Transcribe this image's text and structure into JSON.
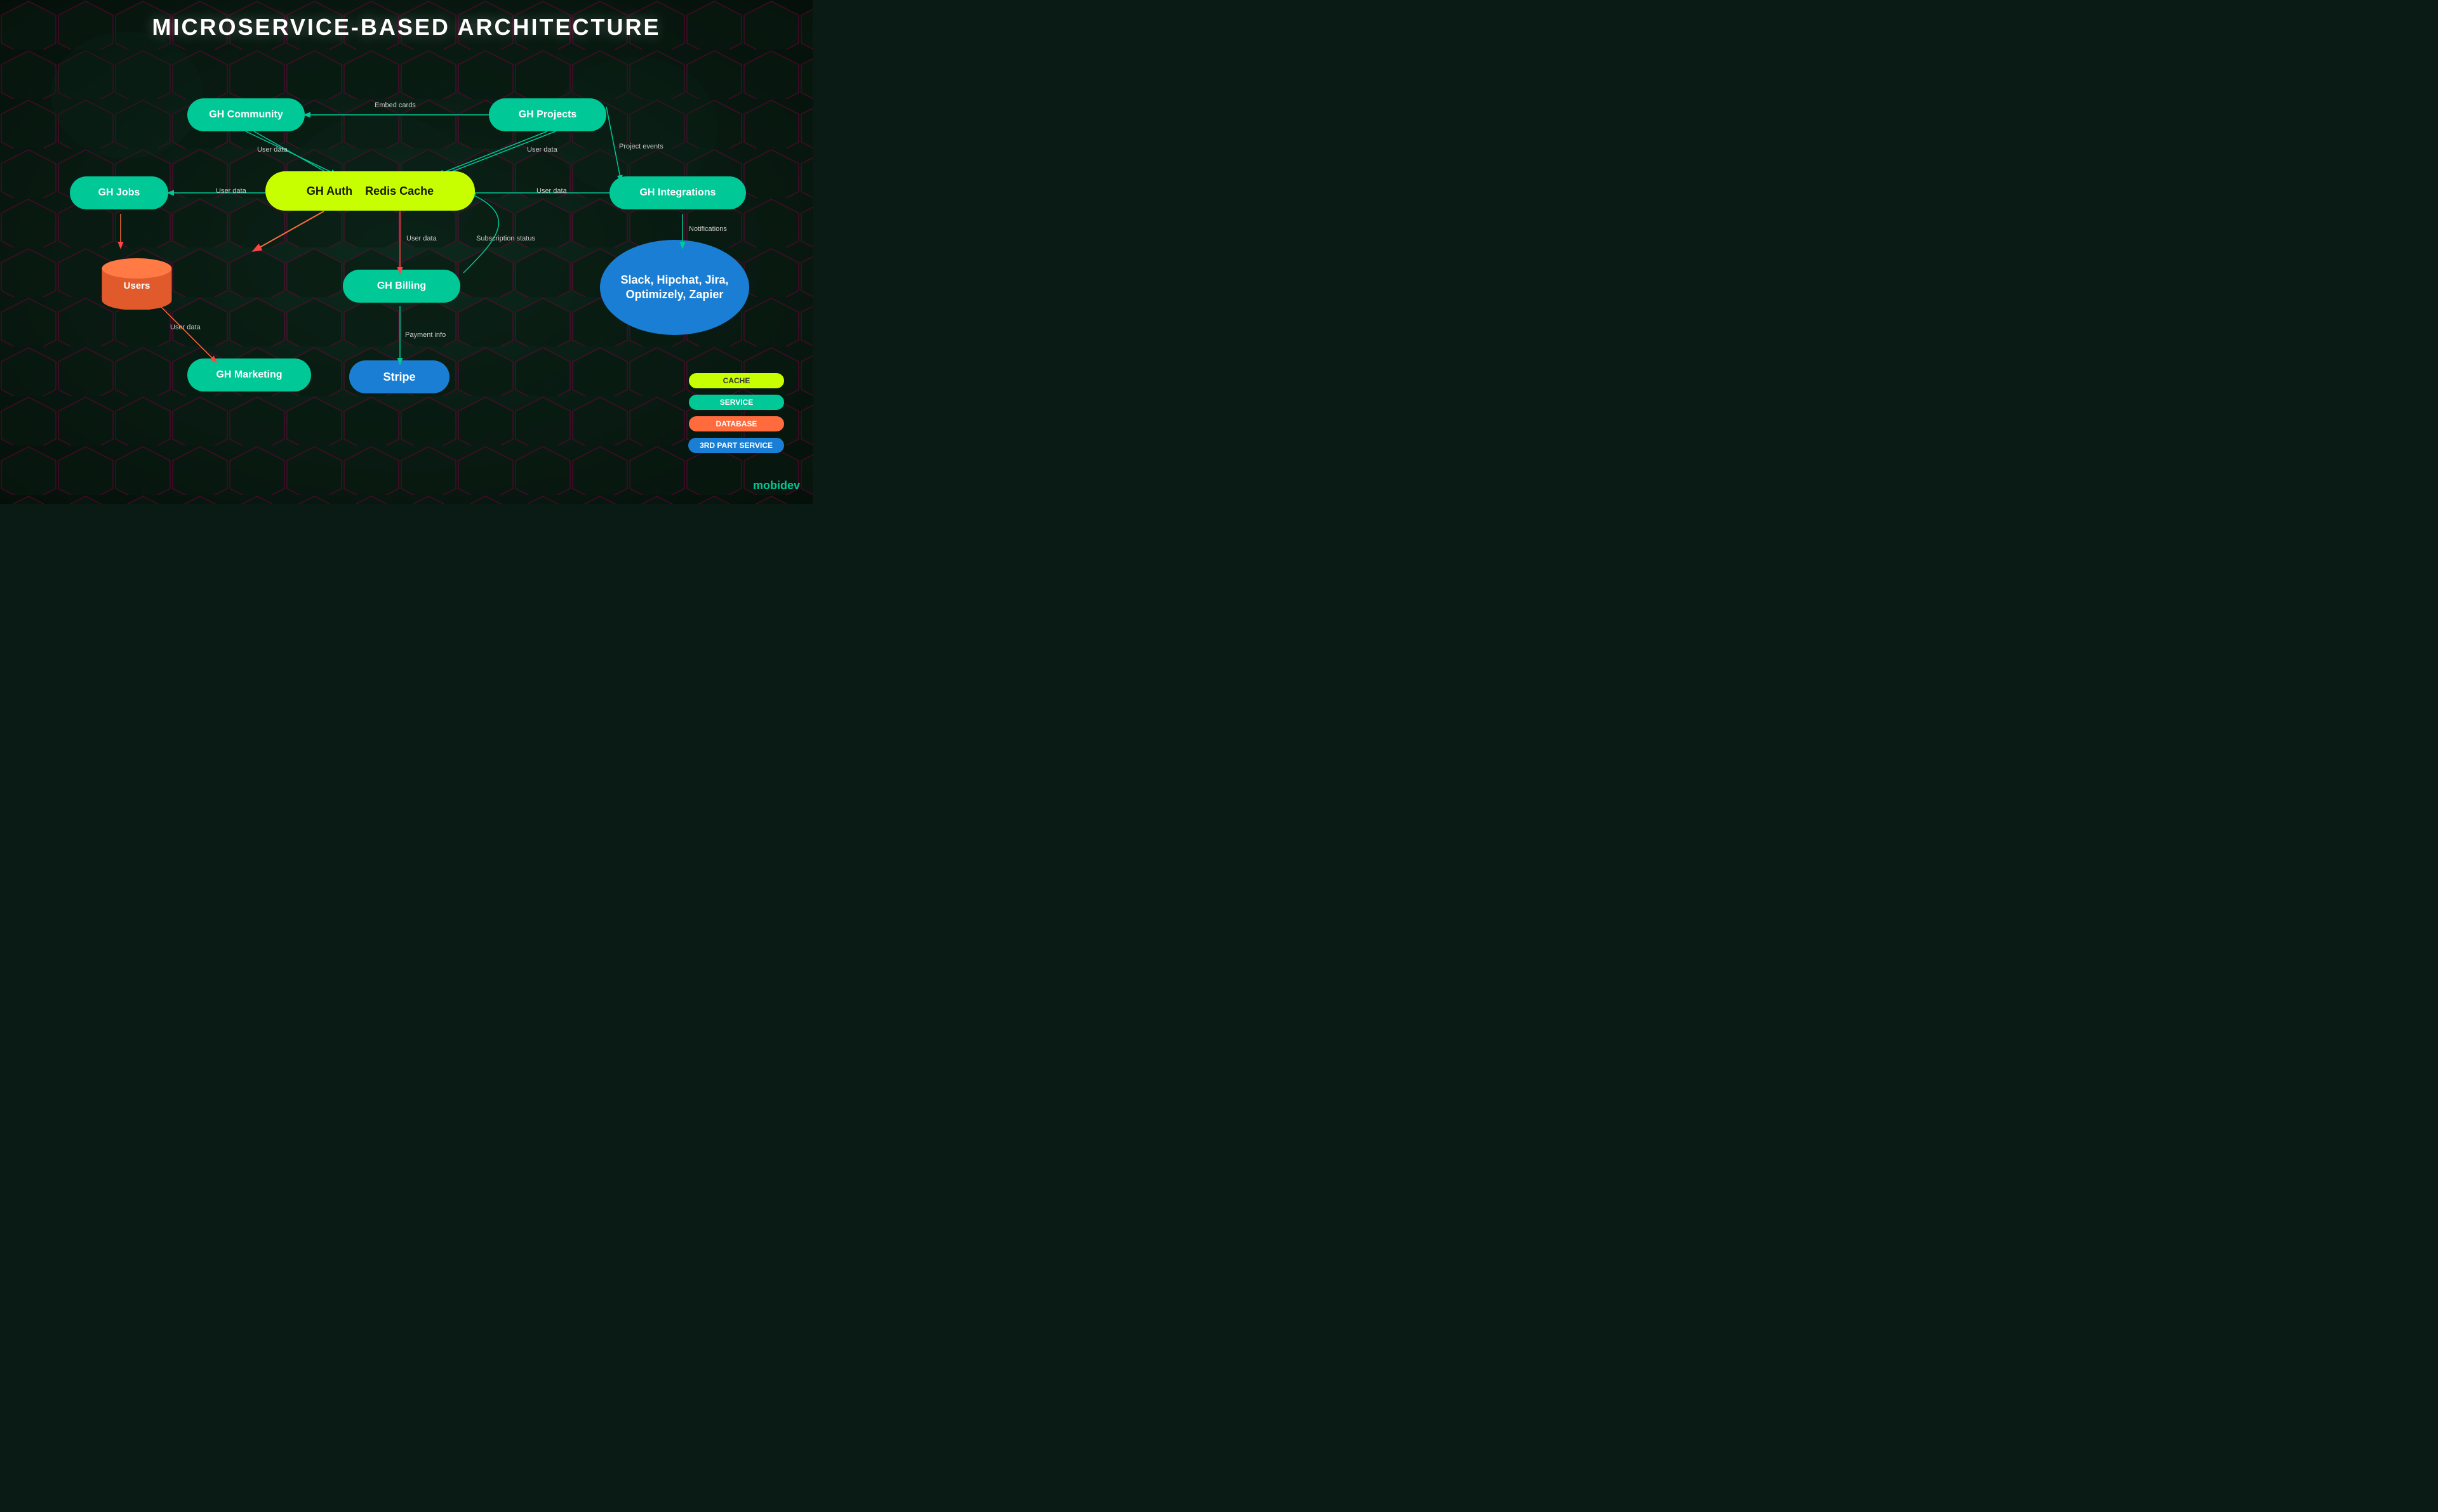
{
  "title": "MICROSERVICE-BASED ARCHITECTURE",
  "nodes": {
    "gh_community": {
      "label": "GH Community",
      "type": "service"
    },
    "gh_projects": {
      "label": "GH Projects",
      "type": "service"
    },
    "gh_jobs": {
      "label": "GH Jobs",
      "type": "service"
    },
    "gh_auth": {
      "label": "GH Auth",
      "type": "cache"
    },
    "redis_cache": {
      "label": "Redis Cache",
      "type": "cache"
    },
    "gh_integrations": {
      "label": "GH Integrations",
      "type": "service"
    },
    "users": {
      "label": "Users",
      "type": "database"
    },
    "gh_billing": {
      "label": "GH Billing",
      "type": "service"
    },
    "integrations_services": {
      "label": "Slack, Hipchat, Jira, Optimizely, Zapier",
      "type": "3rdparty"
    },
    "gh_marketing": {
      "label": "GH Marketing",
      "type": "service"
    },
    "stripe": {
      "label": "Stripe",
      "type": "3rdparty_service"
    }
  },
  "edge_labels": {
    "embed_cards": "Embed cards",
    "user_data_community": "User data",
    "user_data_projects": "User data",
    "project_events": "Project events",
    "user_data_jobs": "User data",
    "user_data_integrations": "User data",
    "user_data_billing": "User data",
    "user_data_marketing": "User data",
    "subscription_status": "Subscription status",
    "payment_info": "Payment info",
    "notifications": "Notifications"
  },
  "legend": {
    "items": [
      {
        "label": "CACHE",
        "type": "cache"
      },
      {
        "label": "SERVICE",
        "type": "service"
      },
      {
        "label": "DATABASE",
        "type": "database"
      },
      {
        "label": "3RD PART SERVICE",
        "type": "3rdparty"
      }
    ]
  },
  "logo": {
    "text1": "mobi",
    "text2": "dev"
  }
}
